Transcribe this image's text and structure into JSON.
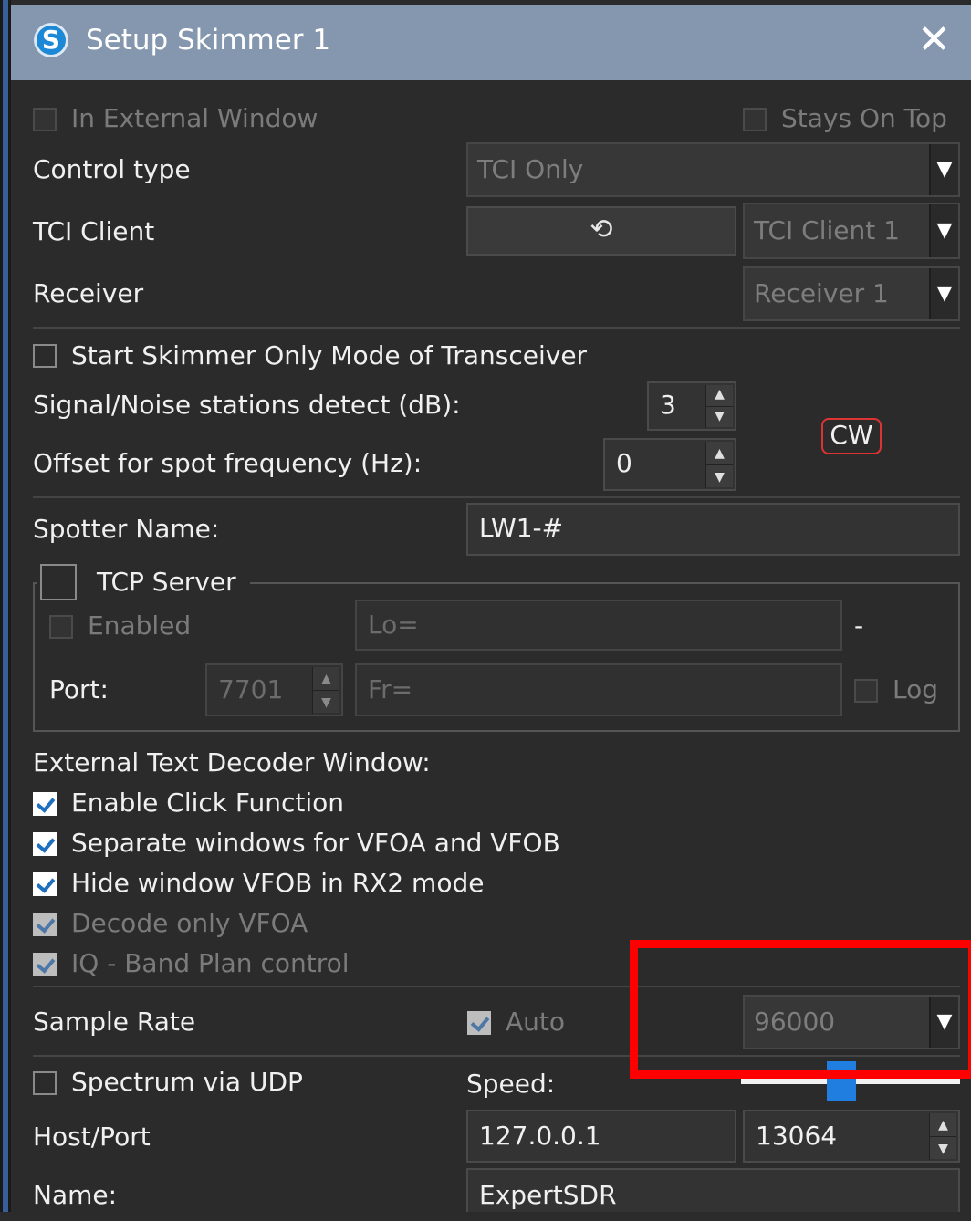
{
  "window": {
    "title": "Setup Skimmer 1",
    "logo_letter": "S",
    "close_glyph": "✕"
  },
  "top": {
    "in_external_window": "In External Window",
    "stays_on_top": "Stays On Top",
    "control_type_label": "Control type",
    "control_type_value": "TCI Only",
    "tci_client_label": "TCI Client",
    "tci_refresh_icon": "⟲",
    "tci_client_value": "TCI Client 1",
    "receiver_label": "Receiver",
    "receiver_value": "Receiver 1",
    "dropdown_arrow": "▼"
  },
  "skimmer": {
    "start_only_mode": "Start Skimmer Only Mode of Transceiver",
    "snr_label": "Signal/Noise stations detect (dB):",
    "snr_value": "3",
    "offset_label": "Offset for spot frequency (Hz):",
    "offset_value": "0",
    "mode_badge": "CW",
    "spotter_label": "Spotter Name:",
    "spotter_value": "LW1-#",
    "spin_up": "▲",
    "spin_down": "▼"
  },
  "tcp": {
    "title": "TCP Server",
    "enabled_label": "Enabled",
    "lo_value": "Lo=",
    "dash": "-",
    "port_label": "Port:",
    "port_value": "7701",
    "fr_value": "Fr=",
    "log_label": "Log"
  },
  "decoder": {
    "heading": "External Text Decoder Window:",
    "options": [
      {
        "label": "Enable Click Function",
        "checked": true,
        "enabled": true
      },
      {
        "label": "Separate windows for VFOA and VFOB",
        "checked": true,
        "enabled": true
      },
      {
        "label": "Hide window VFOB in RX2 mode",
        "checked": true,
        "enabled": true
      },
      {
        "label": "Decode only VFOA",
        "checked": true,
        "enabled": false
      },
      {
        "label": "IQ - Band Plan control",
        "checked": true,
        "enabled": false
      }
    ]
  },
  "sample": {
    "label": "Sample Rate",
    "auto_label": "Auto",
    "value": "96000"
  },
  "udp": {
    "spectrum_label": "Spectrum via UDP",
    "speed_label": "Speed:",
    "speed_level": 0.45,
    "host_label": "Host/Port",
    "host_value": "127.0.0.1",
    "port_value": "13064",
    "name_label": "Name:",
    "name_value": "ExpertSDR"
  },
  "colors": {
    "accent": "#1f7ee0",
    "highlight": "#ff0000",
    "titlebar": "#8497ae"
  }
}
